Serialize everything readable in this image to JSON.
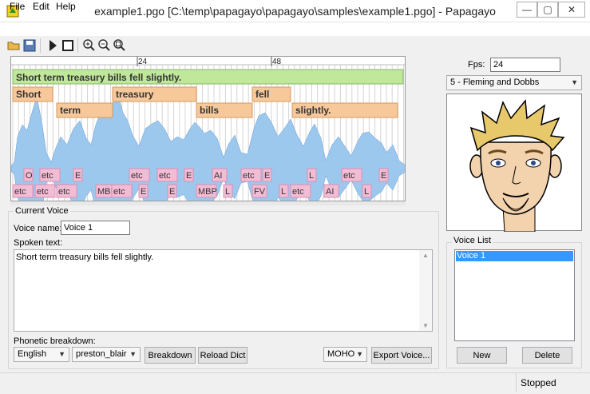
{
  "window": {
    "title": "example1.pgo [C:\\temp\\papagayo\\papagayo\\samples\\example1.pgo] - Papagayo",
    "minimize": "—",
    "maximize": "▢",
    "close": "✕"
  },
  "menu": [
    "File",
    "Edit",
    "Help"
  ],
  "toolbar": [
    "open-icon",
    "save-icon",
    "play-icon",
    "stop-icon",
    "zoom-in-icon",
    "zoom-out-icon",
    "zoom-fit-icon"
  ],
  "timeline": {
    "frame_marks": [
      "24",
      "48"
    ]
  },
  "phrase": "Short term treasury bills fell slightly.",
  "words": [
    "Short",
    "term",
    "treasury",
    "bills",
    "fell",
    "slightly."
  ],
  "phonemes_row1": [
    "O",
    "etc",
    "E",
    "etc",
    "etc",
    "E",
    "AI",
    "etc",
    "E",
    "L",
    "etc",
    "E"
  ],
  "phonemes_row2": [
    "etc",
    "etc",
    "etc",
    "MBP",
    "etc",
    "E",
    "E",
    "MBP",
    "L",
    "FV",
    "L",
    "etc",
    "AI",
    "L"
  ],
  "current_voice": {
    "group_label": "Current Voice",
    "voice_name_label": "Voice name:",
    "voice_name_value": "Voice 1",
    "spoken_text_label": "Spoken text:",
    "spoken_text": "Short term treasury bills fell slightly.",
    "phonetic_label": "Phonetic breakdown:",
    "language": "English",
    "phoneme_set": "preston_blair",
    "breakdown_btn": "Breakdown",
    "reload_btn": "Reload Dict",
    "export_format": "MOHO",
    "export_btn": "Export Voice..."
  },
  "right_panel": {
    "fps_label": "Fps:",
    "fps_value": "24",
    "mouth_set": "5 - Fleming and Dobbs",
    "voice_list_label": "Voice List",
    "voices": [
      "Voice 1"
    ],
    "new_btn": "New",
    "delete_btn": "Delete"
  },
  "status": "Stopped",
  "colors": {
    "phrase_bg": "#bfe89a",
    "word_bg": "#f7c89a",
    "phoneme_bg": "#f2bcd4",
    "wave": "#9cc8ee",
    "selection": "#3399ff"
  }
}
